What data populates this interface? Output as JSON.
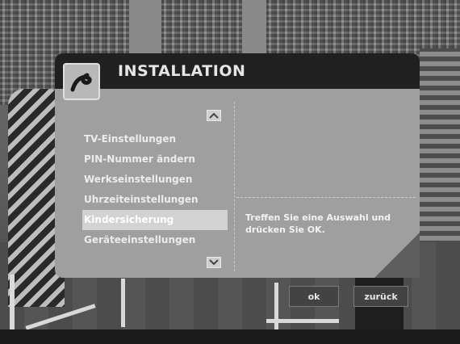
{
  "menu": {
    "title": "INSTALLATION",
    "logo_icon": "swirl-logo-icon",
    "scroll_up_icon": "chevron-up-icon",
    "scroll_down_icon": "chevron-down-icon",
    "items": [
      {
        "label": "TV-Einstellungen"
      },
      {
        "label": "PIN-Nummer ändern"
      },
      {
        "label": "Werkseinstellungen"
      },
      {
        "label": "Uhrzeiteinstellungen"
      },
      {
        "label": "Kindersicherung"
      },
      {
        "label": "Geräteeinstellungen"
      }
    ],
    "selected_index": 4,
    "help_text": "Treffen Sie eine Auswahl und drücken Sie OK."
  },
  "buttons": {
    "ok_label": "ok",
    "back_label": "zurück"
  }
}
